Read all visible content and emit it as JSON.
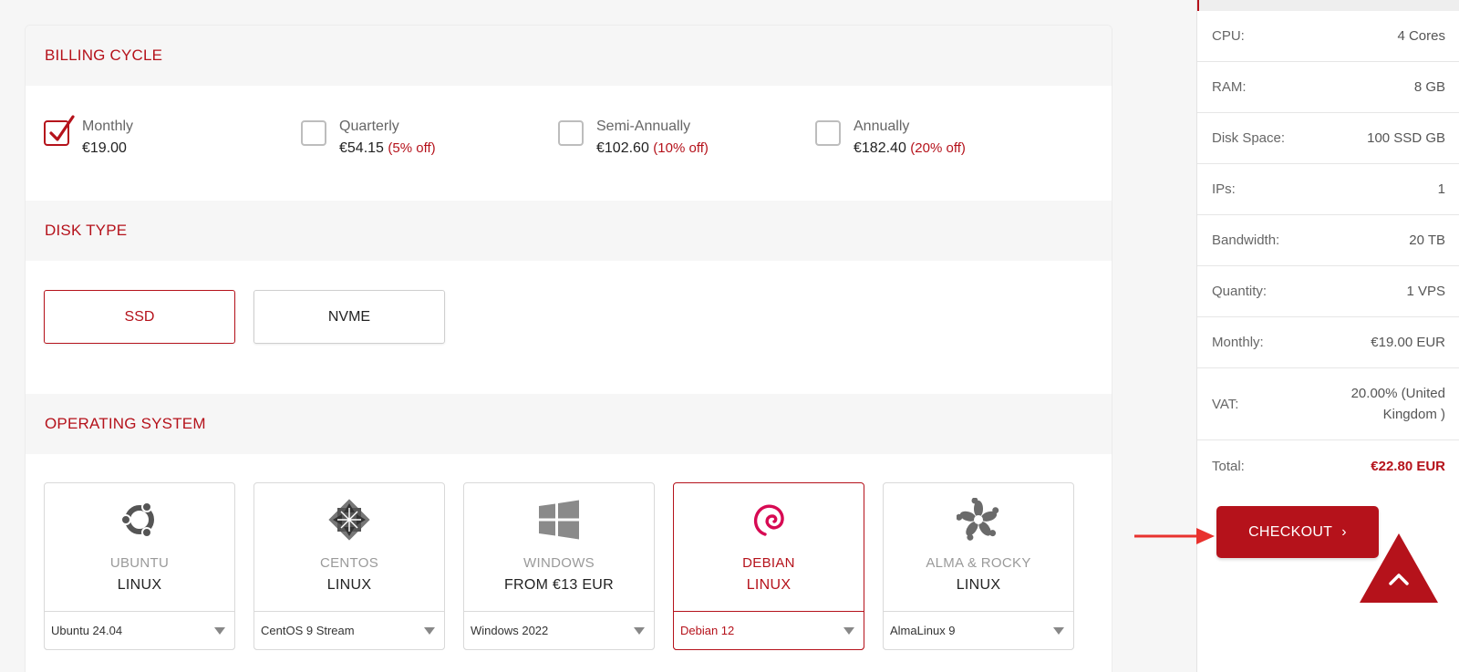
{
  "billing": {
    "title": "BILLING CYCLE",
    "options": [
      {
        "name": "Monthly",
        "price": "€19.00",
        "discount": "",
        "checked": true
      },
      {
        "name": "Quarterly",
        "price": "€54.15",
        "discount": "(5% off)",
        "checked": false
      },
      {
        "name": "Semi-Annually",
        "price": "€102.60",
        "discount": "(10% off)",
        "checked": false
      },
      {
        "name": "Annually",
        "price": "€182.40",
        "discount": "(20% off)",
        "checked": false
      }
    ]
  },
  "disk": {
    "title": "DISK TYPE",
    "options": [
      {
        "label": "SSD",
        "selected": true
      },
      {
        "label": "NVME",
        "selected": false
      }
    ]
  },
  "os": {
    "title": "OPERATING SYSTEM",
    "cards": [
      {
        "name": "UBUNTU",
        "sub": "LINUX",
        "version": "Ubuntu 24.04",
        "icon": "ubuntu-icon",
        "selected": false
      },
      {
        "name": "CENTOS",
        "sub": "LINUX",
        "version": "CentOS 9 Stream",
        "icon": "centos-icon",
        "selected": false
      },
      {
        "name": "WINDOWS",
        "sub": "FROM €13 EUR",
        "version": "Windows 2022",
        "icon": "windows-icon",
        "selected": false
      },
      {
        "name": "DEBIAN",
        "sub": "LINUX",
        "version": "Debian 12",
        "icon": "debian-icon",
        "selected": true
      },
      {
        "name": "ALMA & ROCKY",
        "sub": "LINUX",
        "version": "AlmaLinux 9",
        "icon": "almalinux-icon",
        "selected": false
      }
    ]
  },
  "summary": {
    "rows": [
      {
        "label": "CPU:",
        "value": "4 Cores"
      },
      {
        "label": "RAM:",
        "value": "8 GB"
      },
      {
        "label": "Disk Space:",
        "value": "100 SSD GB"
      },
      {
        "label": "IPs:",
        "value": "1"
      },
      {
        "label": "Bandwidth:",
        "value": "20 TB"
      },
      {
        "label": "Quantity:",
        "value": "1 VPS"
      },
      {
        "label": "Monthly:",
        "value": "€19.00 EUR"
      },
      {
        "label": "VAT:",
        "value": "20.00% (United Kingdom )"
      },
      {
        "label": "Total:",
        "value": "€22.80 EUR"
      }
    ],
    "checkout_label": "CHECKOUT",
    "checkout_icon": "chevron-right-icon"
  },
  "colors": {
    "accent": "#b5121b",
    "header_bg": "#f6f6f6",
    "border": "#d9d9d9"
  }
}
